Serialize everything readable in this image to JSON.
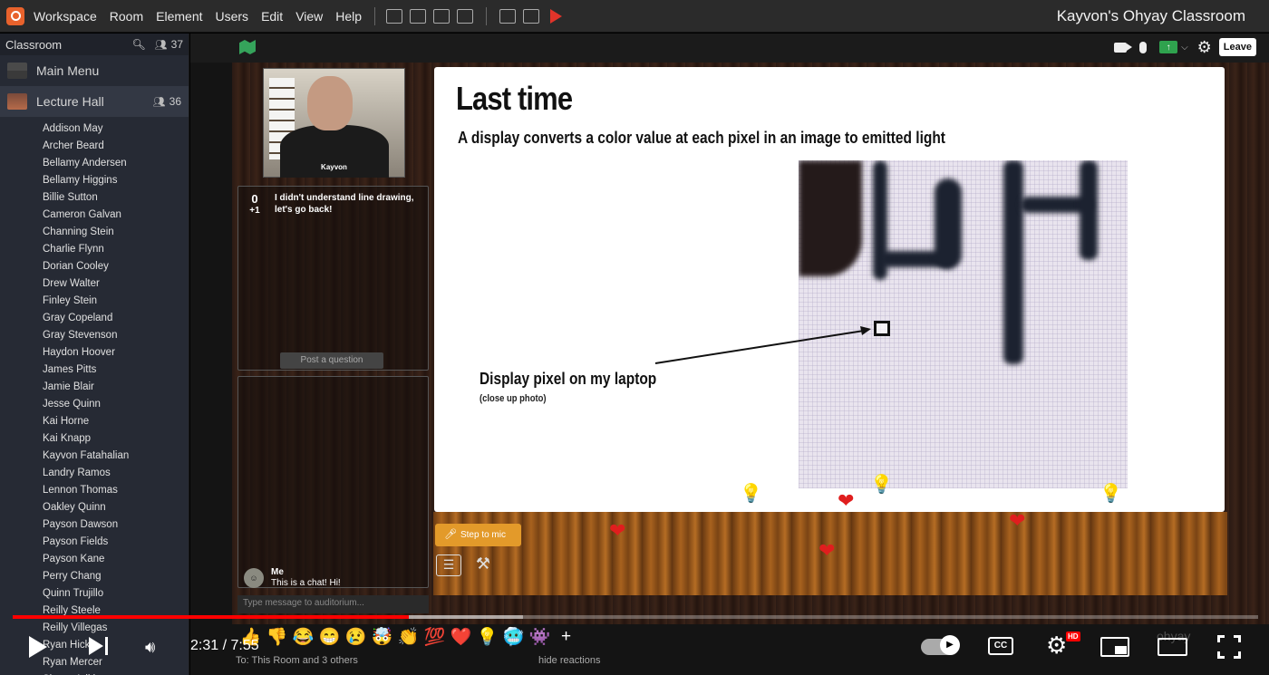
{
  "menubar": {
    "items": [
      "Workspace",
      "Room",
      "Element",
      "Users",
      "Edit",
      "View",
      "Help"
    ],
    "room_title": "Kayvon's Ohyay Classroom"
  },
  "sidebar": {
    "header": {
      "title": "Classroom",
      "count": "37"
    },
    "rooms": [
      {
        "label": "Main Menu"
      },
      {
        "label": "Lecture Hall",
        "count": "36"
      }
    ],
    "participants": [
      "Addison May",
      "Archer Beard",
      "Bellamy Andersen",
      "Bellamy Higgins",
      "Billie Sutton",
      "Cameron Galvan",
      "Channing Stein",
      "Charlie Flynn",
      "Dorian Cooley",
      "Drew Walter",
      "Finley Stein",
      "Gray Copeland",
      "Gray Stevenson",
      "Haydon Hoover",
      "James Pitts",
      "Jamie Blair",
      "Jesse Quinn",
      "Kai Horne",
      "Kai Knapp",
      "Kayvon Fatahalian",
      "Landry Ramos",
      "Lennon Thomas",
      "Oakley Quinn",
      "Payson Dawson",
      "Payson Fields",
      "Payson Kane",
      "Perry Chang",
      "Quinn Trujillo",
      "Reilly Steele",
      "Reilly Villegas",
      "Ryan Hicks",
      "Ryan Mercer",
      "Shaun Adkins"
    ]
  },
  "toolbar": {
    "leave_label": "Leave"
  },
  "video": {
    "name": "Kayvon"
  },
  "questions": {
    "items": [
      {
        "score": "0",
        "plus": "+1",
        "text": "I didn't understand line drawing, let's go back!"
      }
    ],
    "post_label": "Post a question"
  },
  "chat": {
    "author": "Me",
    "message": "This is a chat! Hi!",
    "input_placeholder": "Type message to auditorium..."
  },
  "slide": {
    "title": "Last time",
    "subtitle": "A display converts a color value at each pixel in an image to emitted light",
    "label": "Display pixel on my laptop",
    "sublabel": "(close up photo)"
  },
  "stage": {
    "step_to_mic_label": "Step to mic"
  },
  "player": {
    "time": "2:31 / 7:55",
    "progress": 0.318,
    "buffered": 0.41,
    "cc_label": "CC",
    "hd_label": "HD",
    "watermark": "ohyay"
  },
  "reactions": {
    "emojis": [
      "👍",
      "👎",
      "😂",
      "😁",
      "😢",
      "🤯",
      "👏",
      "💯",
      "❤️",
      "💡",
      "🥶",
      "👾",
      "+"
    ],
    "to_label": "To: This Room and 3 others",
    "hide_label": "hide reactions"
  },
  "colors": {
    "accent": "#e8622c",
    "progress": "#ff0000",
    "mic_button": "#e39a2a",
    "share": "#2fa24e"
  }
}
